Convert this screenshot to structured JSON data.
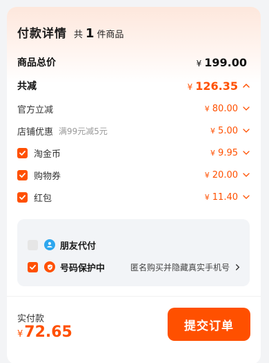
{
  "header": {
    "title": "付款详情",
    "count_prefix": "共",
    "count": "1",
    "count_suffix": "件商品"
  },
  "summary": {
    "total_label": "商品总价",
    "total_currency": "¥",
    "total_amount": "199.00",
    "discount_label": "共减",
    "discount_currency": "¥",
    "discount_amount": "126.35"
  },
  "discounts": [
    {
      "label": "官方立减",
      "note": "",
      "currency": "¥",
      "amount": "80.00",
      "checkbox": false
    },
    {
      "label": "店铺优惠",
      "note": "满99元减5元",
      "currency": "¥",
      "amount": "5.00",
      "checkbox": false
    },
    {
      "label": "淘金币",
      "note": "",
      "currency": "¥",
      "amount": "9.95",
      "checkbox": true
    },
    {
      "label": "购物券",
      "note": "",
      "currency": "¥",
      "amount": "20.00",
      "checkbox": true
    },
    {
      "label": "红包",
      "note": "",
      "currency": "¥",
      "amount": "11.40",
      "checkbox": true
    }
  ],
  "options": {
    "friend_pay_label": "朋友代付",
    "friend_pay_checked": false,
    "privacy_label": "号码保护中",
    "privacy_checked": true,
    "privacy_note": "匿名购买并隐藏真实手机号"
  },
  "footer": {
    "pay_label": "实付款",
    "pay_currency": "¥",
    "pay_amount": "72.65",
    "submit_label": "提交订单"
  },
  "colors": {
    "accent": "#ff5000",
    "panel_bg": "#f2f4f7",
    "friend_icon": "#2ea7ee"
  },
  "icons": {
    "chevron": "chevron-down-icon",
    "checkbox": "check-icon",
    "friend": "friend-pay-icon",
    "shield": "shield-icon",
    "arrow": "chevron-right-icon"
  }
}
